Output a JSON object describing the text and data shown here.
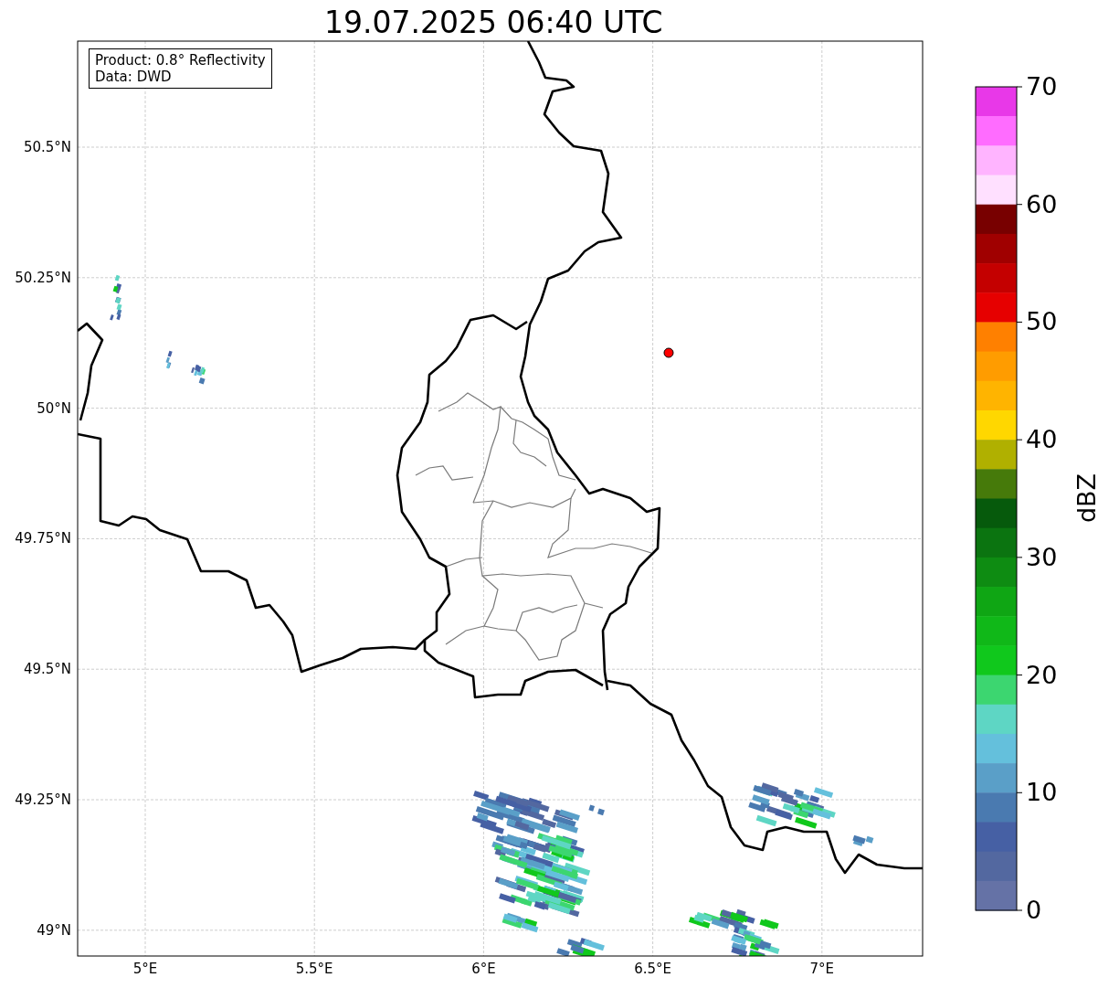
{
  "title": "19.07.2025 06:40 UTC",
  "info_box": [
    "Product: 0.8° Reflectivity",
    "Data: DWD"
  ],
  "y_axis": {
    "ticks": [
      "50.5°N",
      "50.25°N",
      "50°N",
      "49.75°N",
      "49.5°N",
      "49.25°N",
      "49°N"
    ]
  },
  "x_axis": {
    "ticks": [
      "5°E",
      "5.5°E",
      "6°E",
      "6.5°E",
      "7°E"
    ]
  },
  "colorbar": {
    "label": "dBZ",
    "ticks": [
      "70",
      "60",
      "50",
      "40",
      "30",
      "20",
      "10",
      "0"
    ],
    "segments": [
      {
        "color": "#e838e8"
      },
      {
        "color": "#ff6cff"
      },
      {
        "color": "#ffb4ff"
      },
      {
        "color": "#ffe0ff"
      },
      {
        "color": "#780000"
      },
      {
        "color": "#a00000"
      },
      {
        "color": "#c40000"
      },
      {
        "color": "#e60000"
      },
      {
        "color": "#ff8000"
      },
      {
        "color": "#ff9c00"
      },
      {
        "color": "#ffb400"
      },
      {
        "color": "#ffd700"
      },
      {
        "color": "#b0b000"
      },
      {
        "color": "#467a0a"
      },
      {
        "color": "#065a0c"
      },
      {
        "color": "#0b7410"
      },
      {
        "color": "#0e8c12"
      },
      {
        "color": "#0fa614"
      },
      {
        "color": "#10b818"
      },
      {
        "color": "#10c81c"
      },
      {
        "color": "#3cd670"
      },
      {
        "color": "#5ed6c4"
      },
      {
        "color": "#64c0dc"
      },
      {
        "color": "#5a9fc8"
      },
      {
        "color": "#4a7ab0"
      },
      {
        "color": "#4660a4"
      },
      {
        "color": "#5368a0"
      },
      {
        "color": "#6572a6"
      }
    ]
  }
}
